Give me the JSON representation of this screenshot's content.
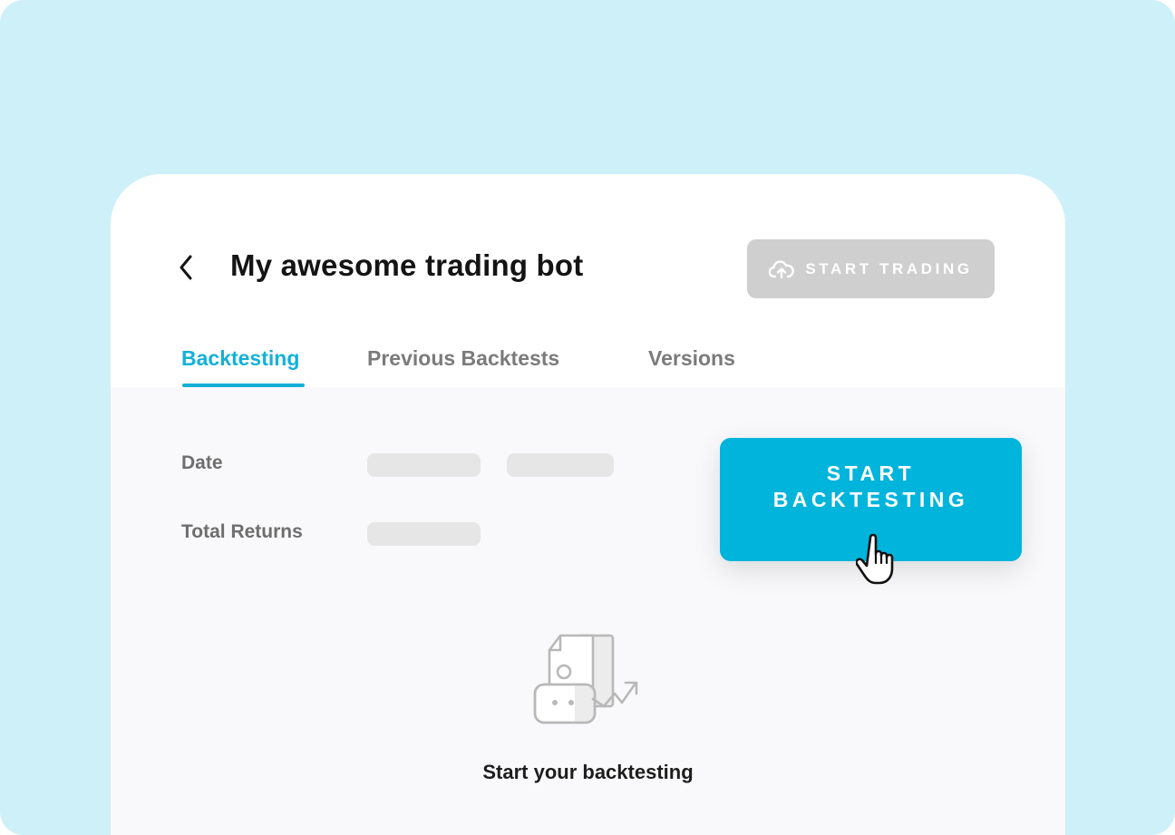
{
  "header": {
    "back_icon": "chevron-left-icon",
    "title": "My awesome trading bot",
    "start_trading": {
      "label": "START TRADING",
      "icon": "cloud-upload-icon",
      "disabled": true
    }
  },
  "tabs": [
    {
      "label": "Backtesting",
      "active": true
    },
    {
      "label": "Previous Backtests",
      "active": false
    },
    {
      "label": "Versions",
      "active": false
    }
  ],
  "form": {
    "date_label": "Date",
    "total_returns_label": "Total Returns"
  },
  "start_backtesting": {
    "line1": "START",
    "line2": "BACKTESTING",
    "cursor_icon": "hand-pointer-icon"
  },
  "empty_state": {
    "icon": "document-bot-growth-icon",
    "text": "Start your backtesting"
  },
  "colors": {
    "accent": "#00b4dc",
    "tab_active": "#14b1d8",
    "background": "#cdf0f9",
    "disabled_button": "#cfcfcf"
  }
}
